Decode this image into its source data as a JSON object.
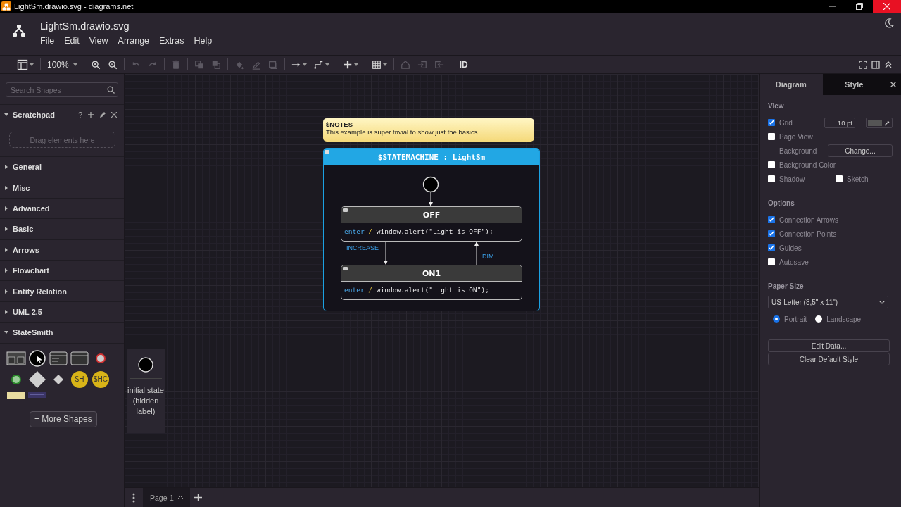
{
  "window": {
    "title": "LightSm.drawio.svg - diagrams.net"
  },
  "header": {
    "file_name": "LightSm.drawio.svg",
    "menu": [
      "File",
      "Edit",
      "View",
      "Arrange",
      "Extras",
      "Help"
    ]
  },
  "toolbar": {
    "zoom": "100%",
    "groups": [
      [
        {
          "kind": "zoom-in",
          "disabled": false
        },
        {
          "kind": "zoom-out",
          "disabled": false
        }
      ],
      [
        {
          "kind": "undo",
          "disabled": true
        },
        {
          "kind": "redo",
          "disabled": true
        }
      ],
      [
        {
          "kind": "delete",
          "disabled": true
        }
      ],
      [
        {
          "kind": "to-front",
          "disabled": true
        },
        {
          "kind": "to-back",
          "disabled": true
        }
      ],
      [
        {
          "kind": "fill",
          "disabled": true
        },
        {
          "kind": "line",
          "disabled": true
        },
        {
          "kind": "shadow",
          "disabled": true
        }
      ],
      [
        {
          "kind": "connection",
          "disabled": false
        },
        {
          "kind": "waypoints",
          "disabled": false
        }
      ],
      [
        {
          "kind": "insert",
          "disabled": false
        }
      ],
      [
        {
          "kind": "table",
          "disabled": false
        }
      ],
      [
        {
          "kind": "home",
          "disabled": true
        },
        {
          "kind": "exit-group",
          "disabled": true
        },
        {
          "kind": "enter-group",
          "disabled": true
        }
      ]
    ],
    "id_label": "ID"
  },
  "sidebar": {
    "search": {
      "placeholder": "Search Shapes"
    },
    "scratchpad": {
      "title": "Scratchpad",
      "expanded": true,
      "help": "?",
      "drop_hint": "Drag elements here"
    },
    "categories": [
      {
        "label": "General",
        "expanded": false
      },
      {
        "label": "Misc",
        "expanded": false
      },
      {
        "label": "Advanced",
        "expanded": false
      },
      {
        "label": "Basic",
        "expanded": false
      },
      {
        "label": "Arrows",
        "expanded": false
      },
      {
        "label": "Flowchart",
        "expanded": false
      },
      {
        "label": "Entity Relation",
        "expanded": false
      },
      {
        "label": "UML 2.5",
        "expanded": false
      },
      {
        "label": "StateSmith",
        "expanded": true
      }
    ],
    "shapes": [
      {
        "kind": "composite"
      },
      {
        "kind": "initial"
      },
      {
        "kind": "code-state"
      },
      {
        "kind": "state"
      },
      {
        "kind": "exit-point"
      },
      {
        "kind": "entry-point"
      },
      {
        "kind": "choice"
      },
      {
        "kind": "small-choice"
      },
      {
        "kind": "history",
        "label": "$H"
      },
      {
        "kind": "history",
        "label": "$HC"
      },
      {
        "kind": "note"
      },
      {
        "kind": "machine"
      }
    ],
    "more_shapes": "+ More Shapes"
  },
  "canvas": {
    "notes": {
      "title": "$NOTES",
      "text": "This example is super trivial to show just the basics."
    },
    "state_machine": {
      "title": "$STATEMACHINE : LightSm"
    },
    "states": [
      {
        "name": "OFF",
        "trigger": "enter",
        "separator": "/",
        "action": "window.alert(\"Light is OFF\");"
      },
      {
        "name": "ON1",
        "trigger": "enter",
        "separator": "/",
        "action": "window.alert(\"Light is ON\");"
      }
    ],
    "transitions": [
      {
        "label": "INCREASE"
      },
      {
        "label": "DIM"
      }
    ],
    "tooltip": "initial state (hidden label)"
  },
  "pages": [
    {
      "label": "Page-1",
      "selected": true
    }
  ],
  "format_panel": {
    "tabs": [
      {
        "label": "Diagram",
        "selected": true
      },
      {
        "label": "Style",
        "selected": false
      }
    ],
    "view": {
      "title": "View",
      "grid": {
        "label": "Grid",
        "checked": true,
        "size": "10 pt"
      },
      "page_view": {
        "label": "Page View",
        "checked": false
      },
      "background": {
        "label": "Background",
        "button": "Change..."
      },
      "background_color": {
        "label": "Background Color",
        "checked": false
      },
      "shadow": {
        "label": "Shadow",
        "checked": false
      },
      "sketch": {
        "label": "Sketch",
        "checked": false
      }
    },
    "options": {
      "title": "Options",
      "items": [
        {
          "label": "Connection Arrows",
          "checked": true
        },
        {
          "label": "Connection Points",
          "checked": true
        },
        {
          "label": "Guides",
          "checked": true
        },
        {
          "label": "Autosave",
          "checked": false
        }
      ]
    },
    "paper": {
      "title": "Paper Size",
      "size": "US-Letter (8,5\" x 11\")",
      "orientations": [
        {
          "label": "Portrait",
          "selected": true
        },
        {
          "label": "Landscape",
          "selected": false
        }
      ]
    },
    "buttons": [
      "Edit Data...",
      "Clear Default Style"
    ]
  }
}
